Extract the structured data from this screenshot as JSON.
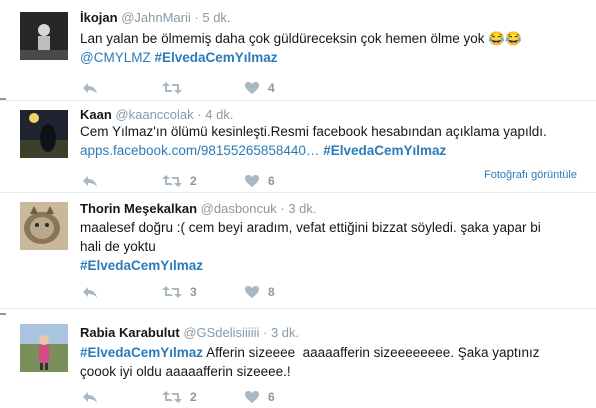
{
  "tweets": [
    {
      "name": "İkojan",
      "handle": "@JahnMarii",
      "time": "5 dk.",
      "line1": "Lan yalan be ölmemiş daha çok güldüreceksin çok hemen ölme yok 😂😂",
      "mention": "@CMYLMZ",
      "hashtag": "#ElvedaCemYılmaz",
      "like_count": "4"
    },
    {
      "name": "Kaan",
      "handle": "@kaanccolak",
      "time": "4 dk.",
      "line1": "Cem Yılmaz'ın ölümü kesinleşti.Resmi facebook hesabından açıklama yapıldı.",
      "link": "apps.facebook.com/98155265858440…",
      "hashtag": "#ElvedaCemYılmaz",
      "retweet_count": "2",
      "like_count": "6",
      "photo_link": "Fotoğrafı görüntüle"
    },
    {
      "name": "Thorin Meşekalkan",
      "handle": "@dasboncuk",
      "time": "3 dk.",
      "line1": "maalesef doğru :( cem beyi aradım, vefat ettiğini bizzat söyledi. şaka yapar bi",
      "line2": "hali de yoktu",
      "hashtag": "#ElvedaCemYılmaz",
      "retweet_count": "3",
      "like_count": "8"
    },
    {
      "name": "Rabia Karabulut",
      "handle": "@GSdelisiiiiii",
      "time": "3 dk.",
      "hashtag": "#ElvedaCemYılmaz",
      "line1_rest": " Afferin sizeeee  aaaaafferin sizeeeeeeee. Şaka yaptınız",
      "line2": "çoook iyi oldu aaaaafferin sizeeee.!",
      "retweet_count": "2",
      "like_count": "6"
    }
  ],
  "separator_dot": "·"
}
